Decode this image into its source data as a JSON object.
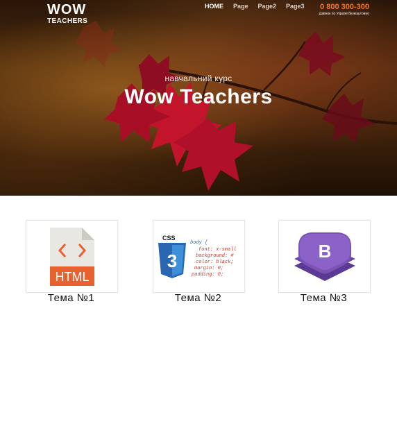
{
  "logo": {
    "line1": "WOW",
    "line2": "TEACHERS"
  },
  "nav": {
    "items": [
      "HOME",
      "Page",
      "Page2",
      "Page3"
    ],
    "active": "HOME"
  },
  "contact": {
    "phone": "0 800 300-300",
    "note": "дзвінок по Україні безкоштовно"
  },
  "hero": {
    "subtitle": "навчальний курс",
    "title": "Wow Teachers"
  },
  "topics": [
    {
      "label": "Тема №1",
      "icon": "html-file-icon",
      "icon_text": "HTML"
    },
    {
      "label": "Тема №2",
      "icon": "css3-icon",
      "icon_text": "CSS"
    },
    {
      "label": "Тема №3",
      "icon": "bootstrap-icon",
      "icon_text": "B"
    }
  ],
  "css_snippet": [
    "body {",
    "font: x-small",
    "background: #",
    "color: black;",
    "margin: 0;",
    "padding: 0;"
  ],
  "colors": {
    "accent": "#f07a2c",
    "html_orange": "#e8622f",
    "css_blue": "#2a67b3",
    "bootstrap_purple": "#7952b3"
  }
}
